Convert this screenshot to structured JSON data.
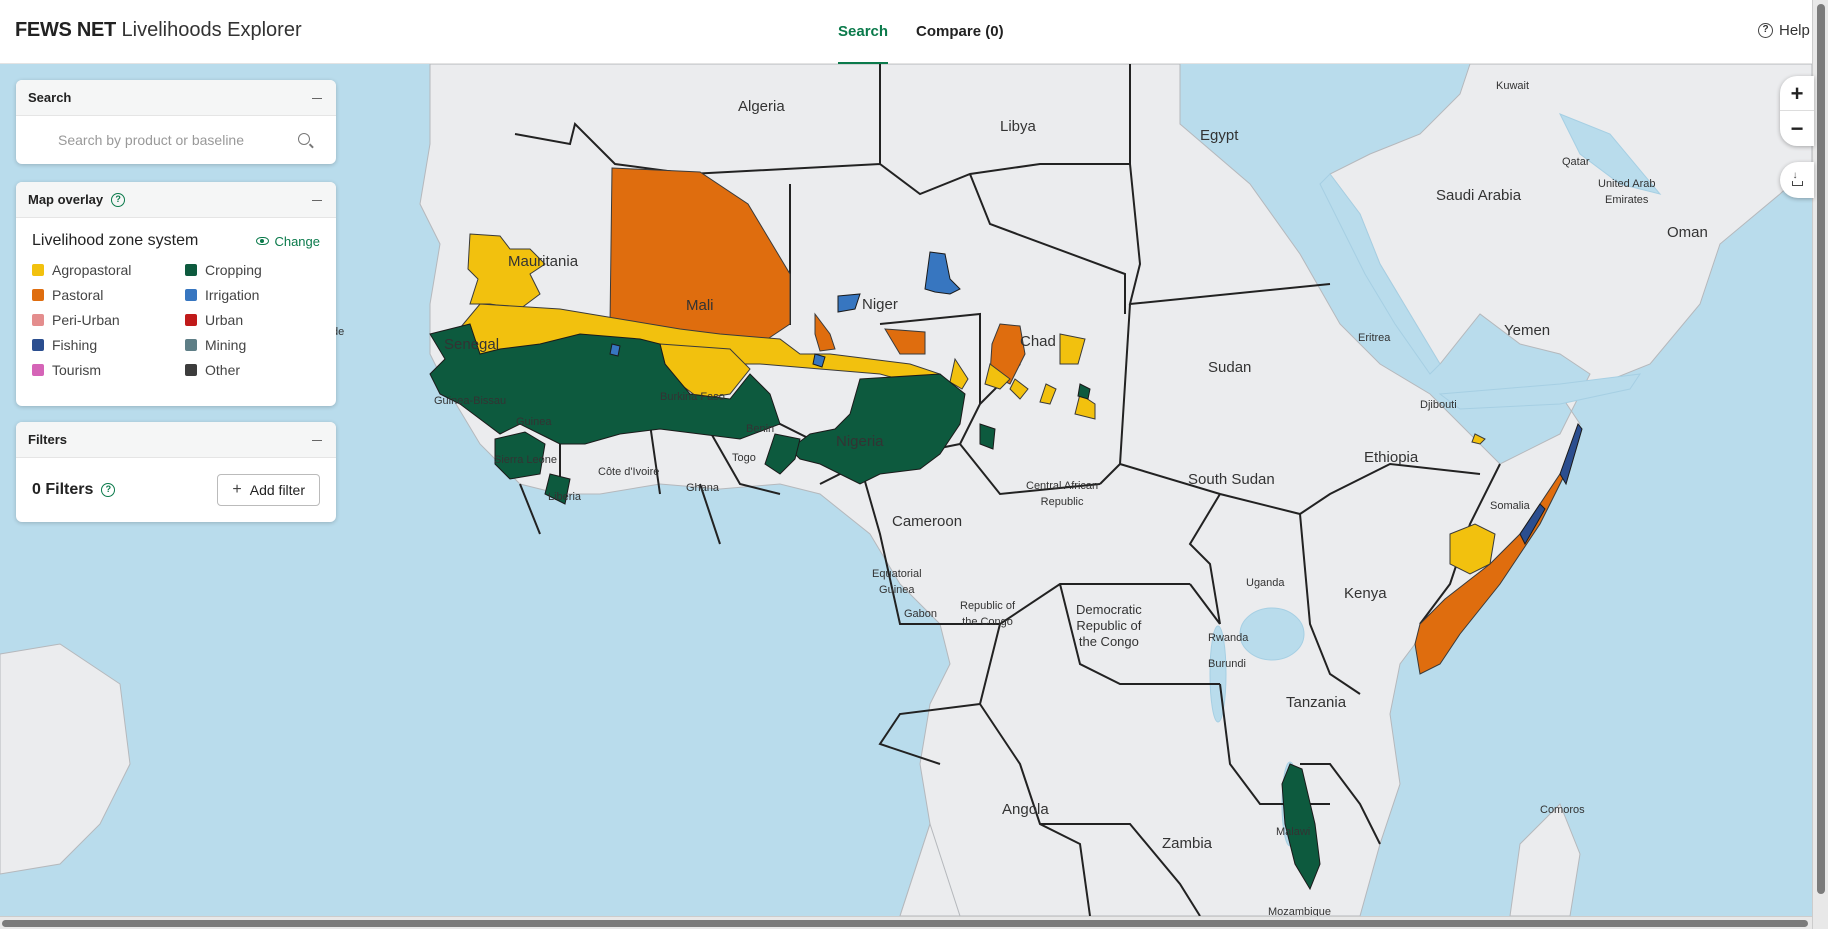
{
  "header": {
    "brand_bold": "FEWS NET",
    "brand_rest": "Livelihoods Explorer",
    "tabs": [
      {
        "label": "Search"
      },
      {
        "label": "Compare (0)"
      }
    ],
    "help_label": "Help"
  },
  "search_panel": {
    "title": "Search",
    "placeholder": "Search by product or baseline"
  },
  "overlay_panel": {
    "title": "Map overlay",
    "zone_system": "Livelihood zone system",
    "change_label": "Change",
    "legend": [
      {
        "label": "Agropastoral",
        "color": "#f2c10e"
      },
      {
        "label": "Cropping",
        "color": "#0d5a3e"
      },
      {
        "label": "Pastoral",
        "color": "#df6d0e"
      },
      {
        "label": "Irrigation",
        "color": "#3776c0"
      },
      {
        "label": "Peri-Urban",
        "color": "#e48d8d"
      },
      {
        "label": "Urban",
        "color": "#c01a1a"
      },
      {
        "label": "Fishing",
        "color": "#2b4e8f"
      },
      {
        "label": "Mining",
        "color": "#5e7e86"
      },
      {
        "label": "Tourism",
        "color": "#d564b7"
      },
      {
        "label": "Other",
        "color": "#3c3c3c"
      }
    ]
  },
  "filters_panel": {
    "title": "Filters",
    "count_label": "0 Filters",
    "add_label": "Add filter"
  },
  "map": {
    "labels": {
      "algeria": "Algeria",
      "libya": "Libya",
      "egypt": "Egypt",
      "kuwait": "Kuwait",
      "qatar": "Qatar",
      "uae": "United Arab\nEmirates",
      "saudi": "Saudi Arabia",
      "oman": "Oman",
      "mauritania": "Mauritania",
      "mali": "Mali",
      "niger": "Niger",
      "chad": "Chad",
      "sudan": "Sudan",
      "eritrea": "Eritrea",
      "yemen": "Yemen",
      "djibouti": "Djibouti",
      "senegal": "Senegal",
      "guinea_bissau": "Guinea-Bissau",
      "guinea": "Guinea",
      "burkina": "Burkina Faso",
      "benin": "Benin",
      "togo": "Togo",
      "nigeria": "Nigeria",
      "ethiopia": "Ethiopia",
      "sierra_leone": "Sierra Leone",
      "liberia": "Liberia",
      "cote": "Côte d'Ivoire",
      "ghana": "Ghana",
      "car": "Central African\nRepublic",
      "south_sudan": "South Sudan",
      "somalia": "Somalia",
      "cameroon": "Cameroon",
      "eq_guinea": "Equatorial\nGuinea",
      "gabon": "Gabon",
      "congo": "Republic of\nthe Congo",
      "drc": "Democratic\nRepublic of\nthe Congo",
      "uganda": "Uganda",
      "kenya": "Kenya",
      "rwanda": "Rwanda",
      "burundi": "Burundi",
      "tanzania": "Tanzania",
      "angola": "Angola",
      "zambia": "Zambia",
      "malawi": "Malawi",
      "comoros": "Comoros",
      "mozambique": "Mozambique",
      "cabo": "de"
    }
  },
  "colors": {
    "accent": "#0b7a4b",
    "ocean": "#b9dcec",
    "land": "#ebecee"
  }
}
